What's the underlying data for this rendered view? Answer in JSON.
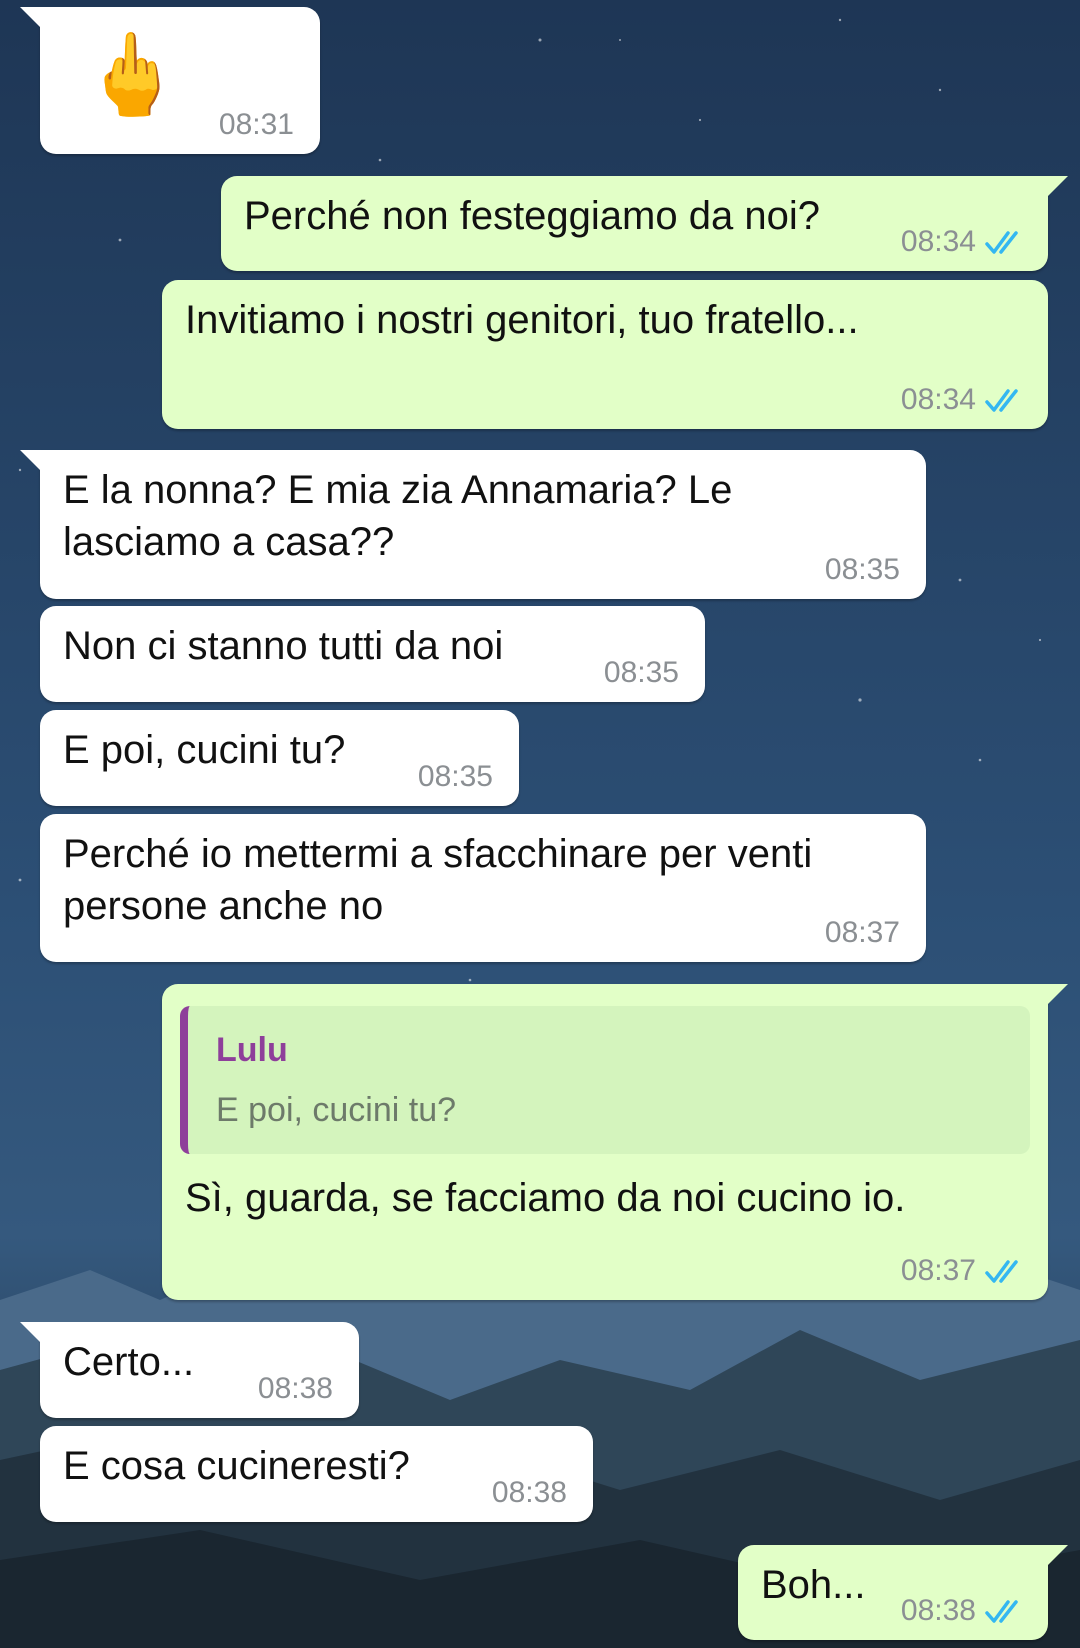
{
  "colors": {
    "incoming_bubble": "#ffffff",
    "outgoing_bubble": "#e2ffc7",
    "quote_accent": "#8e3f9a",
    "read_ticks": "#34b7f1",
    "timestamp": "#8b8f93"
  },
  "messages": [
    {
      "direction": "incoming",
      "emoji": "🖕",
      "time": "08:31"
    },
    {
      "direction": "outgoing",
      "text": "Perché non festeggiamo da noi?",
      "time": "08:34",
      "status_icon": "double-check-read-icon"
    },
    {
      "direction": "outgoing",
      "text": "Invitiamo i nostri genitori, tuo fratello...",
      "time": "08:34",
      "status_icon": "double-check-read-icon"
    },
    {
      "direction": "incoming",
      "text_lines": [
        "E la nonna? E mia zia Annamaria? Le",
        "lasciamo a casa??"
      ],
      "time": "08:35"
    },
    {
      "direction": "incoming",
      "text": "Non ci stanno tutti da noi",
      "time": "08:35"
    },
    {
      "direction": "incoming",
      "text": "E poi, cucini tu?",
      "time": "08:35"
    },
    {
      "direction": "incoming",
      "text_lines": [
        "Perché io mettermi a sfacchinare per venti",
        "persone anche no"
      ],
      "time": "08:37"
    },
    {
      "direction": "outgoing",
      "quote": {
        "author": "Lulu",
        "text": "E poi, cucini tu?"
      },
      "text": "Sì, guarda, se facciamo da noi cucino io.",
      "time": "08:37",
      "status_icon": "double-check-read-icon"
    },
    {
      "direction": "incoming",
      "text": "Certo...",
      "time": "08:38"
    },
    {
      "direction": "incoming",
      "text": "E cosa cucineresti?",
      "time": "08:38"
    },
    {
      "direction": "outgoing",
      "text": "Boh...",
      "time": "08:38",
      "status_icon": "double-check-read-icon"
    }
  ]
}
